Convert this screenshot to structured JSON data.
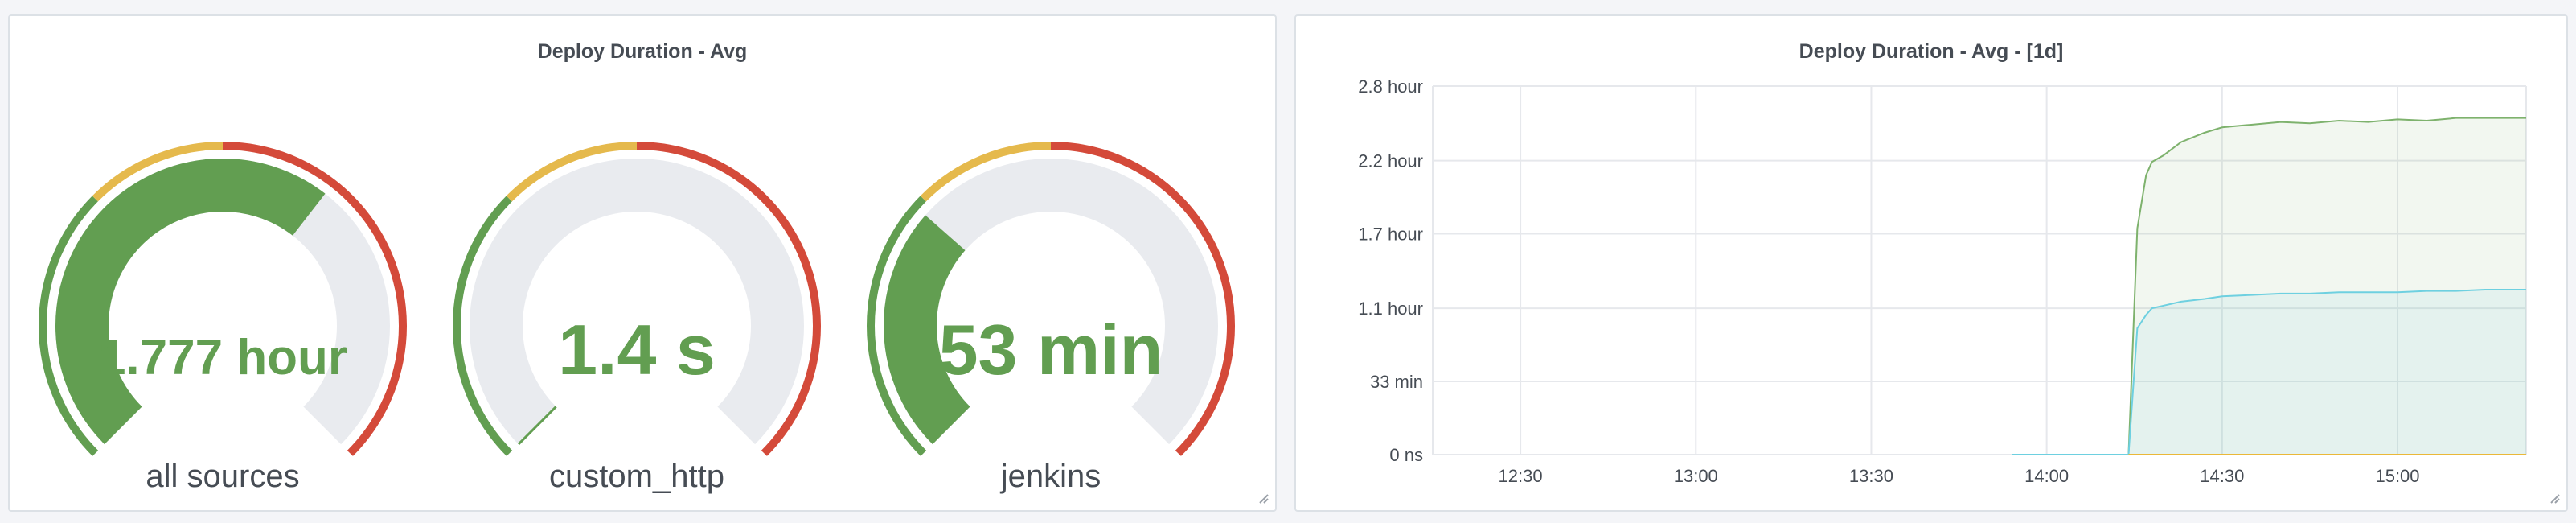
{
  "left_panel": {
    "title": "Deploy Duration - Avg",
    "gauges": [
      {
        "value_text": "1.777 hour",
        "label": "all sources",
        "fill_fraction": 0.64
      },
      {
        "value_text": "1.4 s",
        "label": "custom_http",
        "fill_fraction": 0.0
      },
      {
        "value_text": "53 min",
        "label": "jenkins",
        "fill_fraction": 0.32
      }
    ],
    "colors": {
      "green": "#629e51",
      "yellow": "#e5b94c",
      "red": "#d44a3a",
      "track": "#e9ebef",
      "value": "#629e51",
      "label": "#464c54"
    }
  },
  "right_panel": {
    "title": "Deploy Duration - Avg - [1d]",
    "chart_data": {
      "type": "line",
      "title": "Deploy Duration - Avg - [1d]",
      "y_ticks": [
        "0 ns",
        "33 min",
        "1.1 hour",
        "1.7 hour",
        "2.2 hour",
        "2.8 hour"
      ],
      "x_ticks": [
        "12:30",
        "13:00",
        "13:30",
        "14:00",
        "14:30",
        "15:00"
      ],
      "x_range": [
        "12:15",
        "15:22"
      ],
      "y_range_hours": [
        0,
        2.77
      ],
      "grid": true,
      "legend": "none",
      "series": [
        {
          "color": "#7eb26d",
          "x": [
            "13:54",
            "14:14",
            "14:15:30",
            "14:17",
            "14:18",
            "14:20",
            "14:23",
            "14:27",
            "14:30",
            "14:35",
            "14:40",
            "14:45",
            "14:50",
            "14:55",
            "15:00",
            "15:05",
            "15:10",
            "15:15",
            "15:22"
          ],
          "y_hours": [
            0,
            0,
            1.7,
            2.1,
            2.2,
            2.25,
            2.35,
            2.42,
            2.46,
            2.48,
            2.5,
            2.49,
            2.51,
            2.5,
            2.52,
            2.51,
            2.53,
            2.53,
            2.53
          ]
        },
        {
          "color": "#6ed0e0",
          "x": [
            "13:54",
            "14:14",
            "14:15:30",
            "14:17",
            "14:18",
            "14:20",
            "14:23",
            "14:27",
            "14:30",
            "14:35",
            "14:40",
            "14:45",
            "14:50",
            "14:55",
            "15:00",
            "15:05",
            "15:10",
            "15:15",
            "15:22"
          ],
          "y_hours": [
            0,
            0,
            0.95,
            1.05,
            1.1,
            1.12,
            1.15,
            1.17,
            1.19,
            1.2,
            1.21,
            1.21,
            1.22,
            1.22,
            1.22,
            1.23,
            1.23,
            1.24,
            1.24
          ]
        },
        {
          "color": "#eab839",
          "x": [
            "14:14",
            "15:22"
          ],
          "y_hours": [
            0,
            0
          ]
        }
      ],
      "fills": {
        "green": "#7eb26d",
        "cyan": "#6ed0e0"
      },
      "grid_color": "#e6e8ec",
      "tick_color": "#464c54"
    }
  }
}
